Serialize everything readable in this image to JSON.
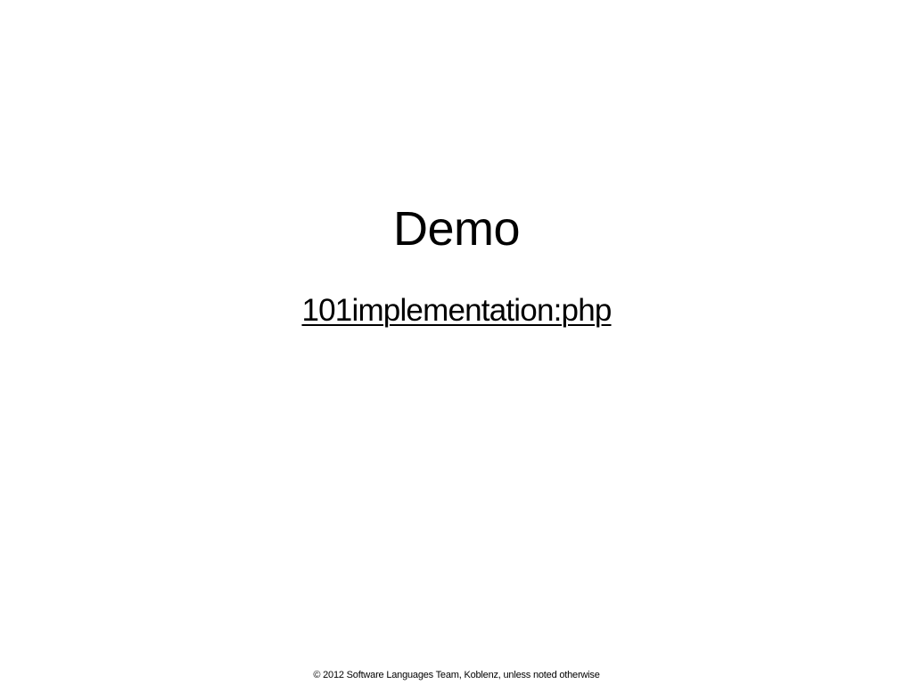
{
  "slide": {
    "title": "Demo",
    "link_text": "101implementation:php",
    "footer": "© 2012 Software Languages Team, Koblenz, unless noted otherwise"
  }
}
